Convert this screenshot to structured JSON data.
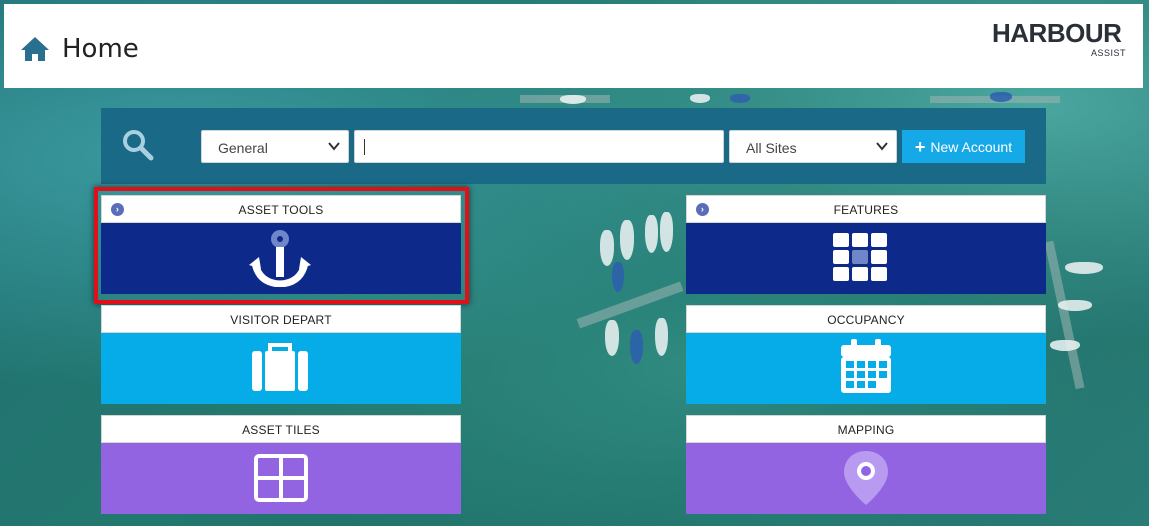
{
  "header": {
    "title": "Home",
    "home_icon": "home-icon",
    "logo": {
      "main": "HARBOUR",
      "sub": "ASSIST"
    }
  },
  "search": {
    "category_value": "General",
    "query_value": "",
    "site_value": "All Sites",
    "new_account_label": "New Account",
    "accent_color": "#15a9e8"
  },
  "tiles": [
    {
      "label": "ASSET TOOLS",
      "icon": "anchor-icon",
      "color": "#0d2a8a",
      "has_chevron": true,
      "highlighted": true
    },
    {
      "label": "FEATURES",
      "icon": "grid-dots-icon",
      "color": "#0d2a8a",
      "has_chevron": true
    },
    {
      "label": "VISITOR DEPART",
      "icon": "suitcase-icon",
      "color": "#05ace8"
    },
    {
      "label": "OCCUPANCY",
      "icon": "calendar-icon",
      "color": "#05ace8"
    },
    {
      "label": "ASSET TILES",
      "icon": "window-grid-icon",
      "color": "#9264e2"
    },
    {
      "label": "MAPPING",
      "icon": "map-pin-icon",
      "color": "#9264e2"
    }
  ],
  "colors": {
    "searchbar_bg": "#1a6a87",
    "highlight_border": "#e0101a"
  }
}
